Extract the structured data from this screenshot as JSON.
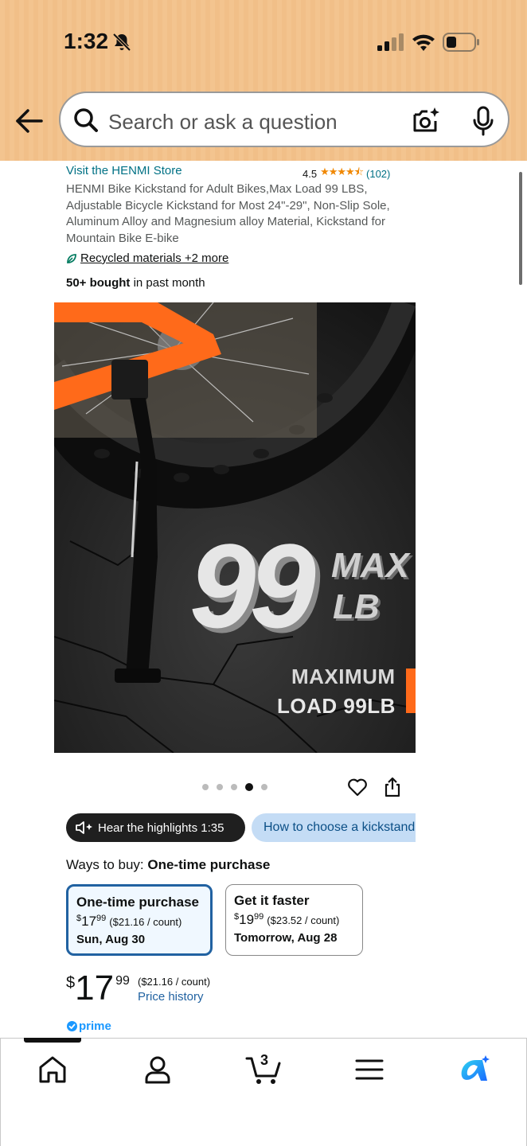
{
  "status_bar": {
    "time": "1:32",
    "icons": [
      "bell-slash-icon",
      "cellular-signal-icon",
      "wifi-icon",
      "battery-icon"
    ]
  },
  "header": {
    "back_icon": "arrow-left-icon",
    "search_placeholder": "Search or ask a question",
    "camera_icon": "camera-sparkle-icon",
    "mic_icon": "microphone-icon",
    "background_color": "#f3c48f"
  },
  "product": {
    "store_link": "Visit the HENMI Store",
    "rating_value": "4.5",
    "rating_stars": "★★★★⯪",
    "rating_count": "(102)",
    "title": "HENMI Bike Kickstand for Adult Bikes,Max Load 99 LBS, Adjustable Bicycle Kickstand for Most 24\"-29\", Non-Slip Sole, Aluminum Alloy and Magnesium alloy Material, Kickstand for Mountain Bike E-bike",
    "recycled": "Recycled materials +2 more",
    "bought_bold": "50+ bought",
    "bought_rest": " in past month"
  },
  "image": {
    "big_number": "99",
    "max_text": "MAX",
    "lb_text": "LB",
    "caption_line1": "MAXIMUM",
    "caption_line2": "LOAD 99LB"
  },
  "carousel": {
    "dot_count": 5,
    "active_index": 3
  },
  "chips": {
    "hear_label": "Hear the highlights 1:35",
    "how_label": "How to choose a kickstand"
  },
  "purchase": {
    "ways_label": "Ways to buy: ",
    "ways_value": "One-time purchase",
    "options": [
      {
        "title": "One-time purchase",
        "currency": "$",
        "whole": "17",
        "cents": "99",
        "unit": "($21.16 / count)",
        "date": "Sun, Aug 30",
        "selected": true
      },
      {
        "title": "Get it faster",
        "currency": "$",
        "whole": "19",
        "cents": "99",
        "unit": "($23.52 / count)",
        "date": "Tomorrow, Aug 28",
        "selected": false
      }
    ],
    "price_currency": "$",
    "price_whole": "17",
    "price_cents": "99",
    "price_unit": "($21.16 / count)",
    "price_history": "Price history",
    "prime": "prime"
  },
  "bottom_nav": {
    "items": [
      "home-icon",
      "account-icon",
      "cart-icon",
      "menu-icon",
      "rufus-icon"
    ],
    "cart_count": "3"
  },
  "colors": {
    "link": "#007185",
    "price_link": "#2162a1",
    "star": "#f08804",
    "selected_border": "#2162a1",
    "prime": "#1a98ff",
    "chip_blue": "#c4dcf5"
  }
}
